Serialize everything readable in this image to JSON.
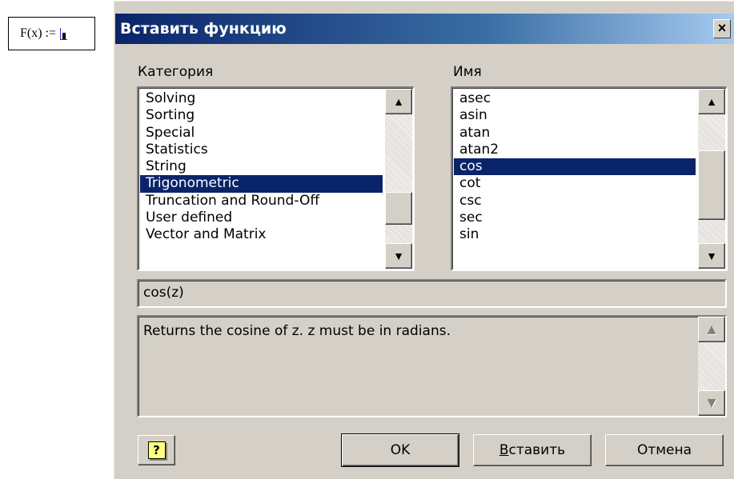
{
  "worksheet": {
    "expression": "F(x) :="
  },
  "dialog": {
    "title": "Вставить функцию",
    "close_glyph": "×",
    "category_label": "Категория",
    "name_label": "Имя",
    "categories": [
      "Solving",
      "Sorting",
      "Special",
      "Statistics",
      "String",
      "Trigonometric",
      "Truncation and Round-Off",
      "User defined",
      "Vector and Matrix"
    ],
    "selected_category": "Trigonometric",
    "names": [
      "asec",
      "asin",
      "atan",
      "atan2",
      "cos",
      "cot",
      "csc",
      "sec",
      "sin"
    ],
    "selected_name": "cos",
    "signature": "cos(z)",
    "description": "Returns the cosine of z. z must be in radians.",
    "buttons": {
      "ok": "OK",
      "insert_accel": "В",
      "insert_rest": "ставить",
      "cancel": "Отмена",
      "help_glyph": "?"
    }
  }
}
